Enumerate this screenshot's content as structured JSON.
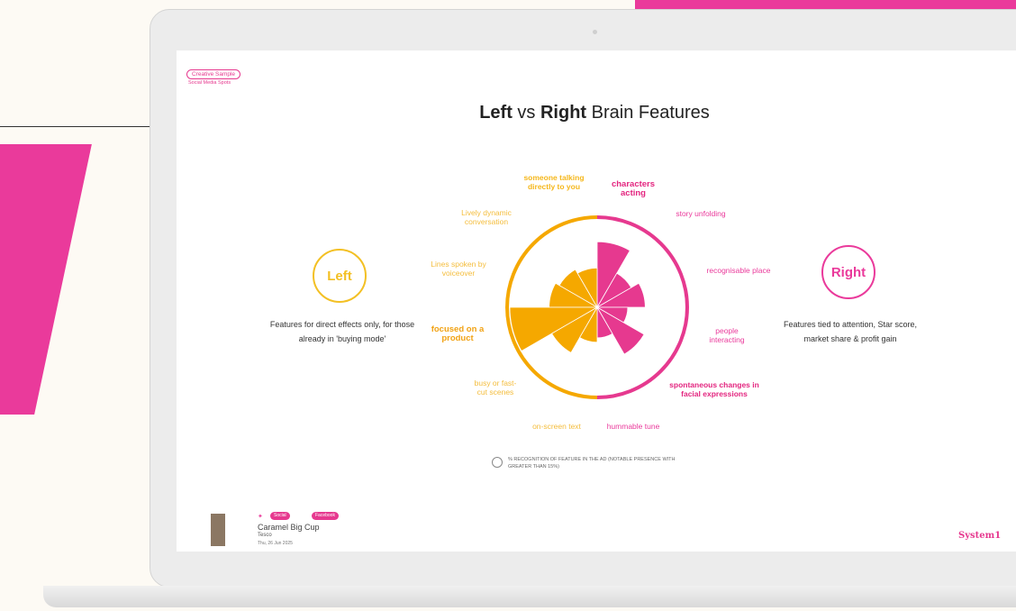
{
  "slide": {
    "tag": "Creative Sample",
    "sublink": "Social Media Spots",
    "title_left": "Left",
    "title_vs": " vs ",
    "title_right": "Right",
    "title_tail": " Brain Features"
  },
  "left_panel": {
    "badge": "Left",
    "description": "Features for direct effects only, for those already in 'buying mode'"
  },
  "right_panel": {
    "badge": "Right",
    "description": "Features tied to attention, Star score, market share & profit gain"
  },
  "colors": {
    "left": "#f5a800",
    "right": "#e6398f",
    "brand": "#e6398f"
  },
  "chart_data": {
    "type": "polar-area",
    "left_features": [
      {
        "label": "someone talking directly to you",
        "value": 0.45,
        "emphasis": true
      },
      {
        "label": "Lively dynamic conversation",
        "value": 0.5
      },
      {
        "label": "Lines spoken by voiceover",
        "value": 0.55
      },
      {
        "label": "focused on a product",
        "value": 1.0,
        "emphasis": true
      },
      {
        "label": "busy or fast-cut scenes",
        "value": 0.6
      },
      {
        "label": "on-screen text",
        "value": 0.4
      }
    ],
    "right_features": [
      {
        "label": "characters acting",
        "value": 0.75,
        "emphasis": true
      },
      {
        "label": "story unfolding",
        "value": 0.45
      },
      {
        "label": "recognisable place",
        "value": 0.55
      },
      {
        "label": "people interacting",
        "value": 0.35
      },
      {
        "label": "spontaneous changes in facial expressions",
        "value": 0.62,
        "emphasis": true
      },
      {
        "label": "hummable tune",
        "value": 0.35
      }
    ],
    "legend": "% RECOGNITION OF FEATURE IN THE AD (NOTABLE PRESENCE WITH GREATER THAN 15%)"
  },
  "footer": {
    "tag_1": "Social Video",
    "tag_2": "Facebook",
    "ad_title": "Caramel Big Cup",
    "brand": "Tesco",
    "date": "Thu, 26 Jun 2025",
    "logo": "System1"
  }
}
